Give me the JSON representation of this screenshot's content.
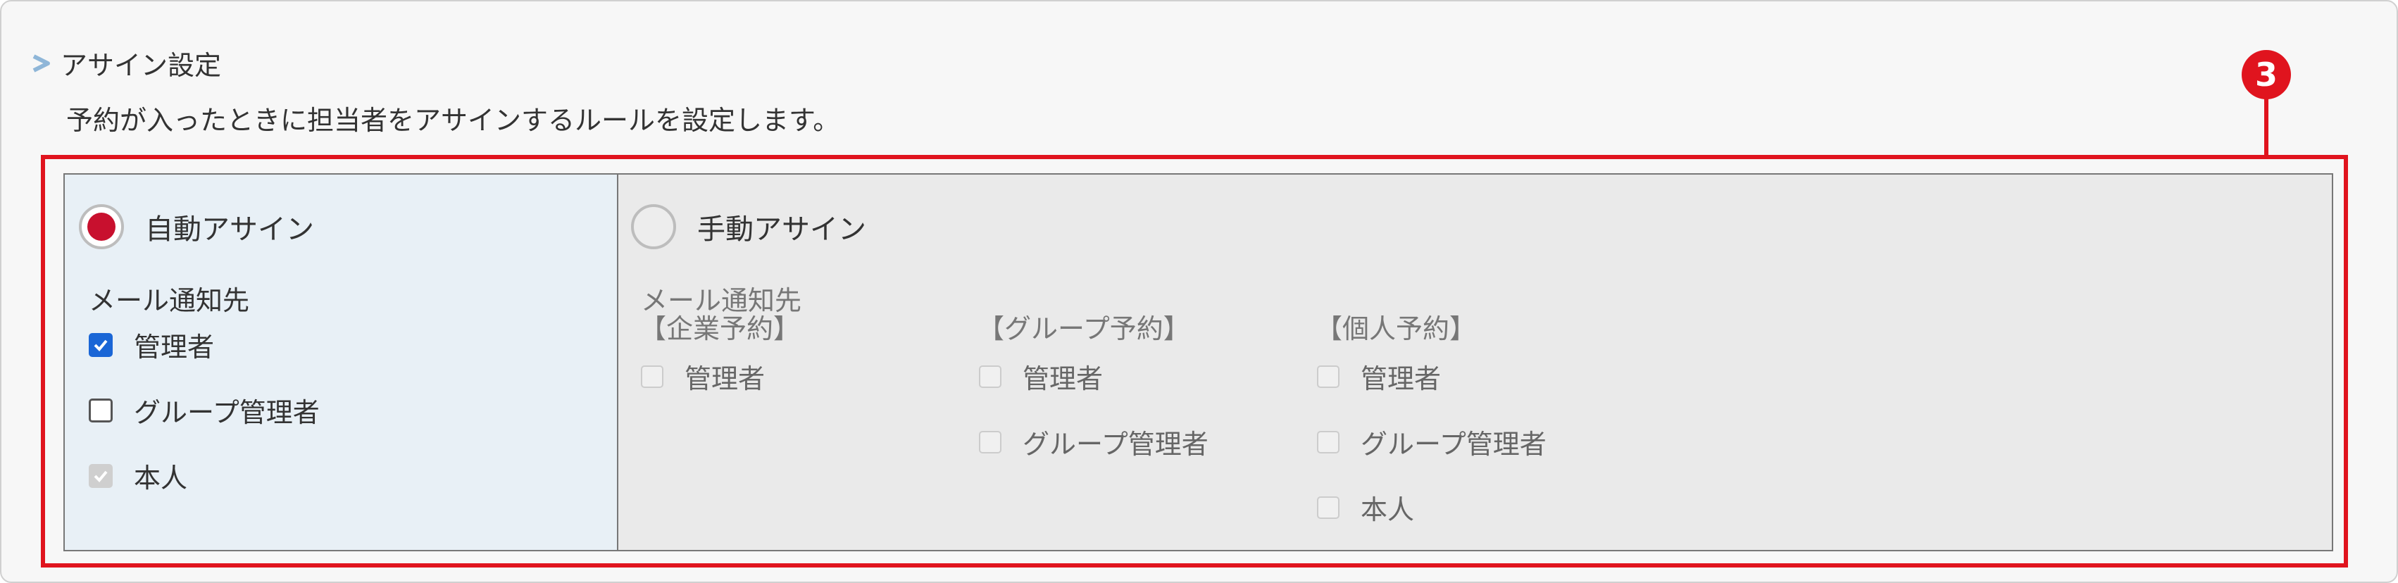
{
  "section": {
    "title": "アサイン設定",
    "description": "予約が入ったときに担当者をアサインするルールを設定します。",
    "marker_number": "3"
  },
  "auto": {
    "radio_label": "自動アサイン",
    "selected": true,
    "mail_label": "メール通知先",
    "options": [
      {
        "label": "管理者",
        "checked": true,
        "disabled": false
      },
      {
        "label": "グループ管理者",
        "checked": false,
        "disabled": false
      },
      {
        "label": "本人",
        "checked": true,
        "disabled": true
      }
    ]
  },
  "manual": {
    "radio_label": "手動アサイン",
    "selected": false,
    "mail_label": "メール通知先",
    "groups": [
      {
        "title": "【企業予約】",
        "options": [
          "管理者"
        ]
      },
      {
        "title": "【グループ予約】",
        "options": [
          "管理者",
          "グループ管理者"
        ]
      },
      {
        "title": "【個人予約】",
        "options": [
          "管理者",
          "グループ管理者",
          "本人"
        ]
      }
    ]
  },
  "colors": {
    "accent_red": "#e0141e",
    "radio_selected": "#c8102e",
    "checkbox_blue": "#1a66d6"
  }
}
